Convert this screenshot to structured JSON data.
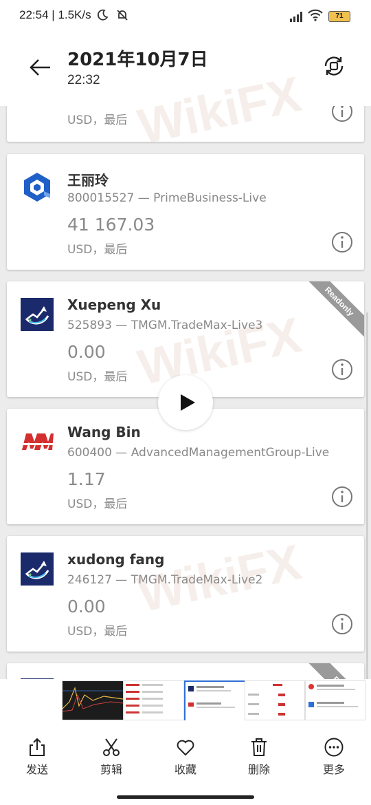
{
  "status_bar": {
    "time": "22:54 | 1.5K/s",
    "battery": "71"
  },
  "header": {
    "title": "2021年10月7日",
    "subtitle": "22:32"
  },
  "cards": [
    {
      "name": "",
      "account": "",
      "balance": "",
      "currency": "USD，最后",
      "readonly": false
    },
    {
      "name": "王丽玲",
      "account": "800015527 — PrimeBusiness-Live",
      "balance": "41 167.03",
      "currency": "USD，最后",
      "readonly": false
    },
    {
      "name": "Xuepeng Xu",
      "account": "525893 — TMGM.TradeMax-Live3",
      "balance": "0.00",
      "currency": "USD，最后",
      "readonly": true,
      "ribbon": "Readonly"
    },
    {
      "name": "Wang Bin",
      "account": "600400 — AdvancedManagementGroup-Live",
      "balance": "1.17",
      "currency": "USD，最后",
      "readonly": false
    },
    {
      "name": "xudong fang",
      "account": "246127 — TMGM.TradeMax-Live2",
      "balance": "0.00",
      "currency": "USD，最后",
      "readonly": false
    },
    {
      "name": "",
      "account": "",
      "balance": "",
      "currency": "",
      "readonly": true,
      "ribbon": "Rea"
    }
  ],
  "watermark": "WikiFX",
  "bottom_actions": [
    {
      "label": "发送",
      "icon": "share-icon"
    },
    {
      "label": "剪辑",
      "icon": "scissors-icon"
    },
    {
      "label": "收藏",
      "icon": "heart-icon"
    },
    {
      "label": "删除",
      "icon": "trash-icon"
    },
    {
      "label": "更多",
      "icon": "more-icon"
    }
  ],
  "colors": {
    "accent": "#2f6fd6",
    "tmgm_navy": "#1b2a6b",
    "amg_red": "#d32f2f",
    "text_gray": "#8a8a8a"
  }
}
